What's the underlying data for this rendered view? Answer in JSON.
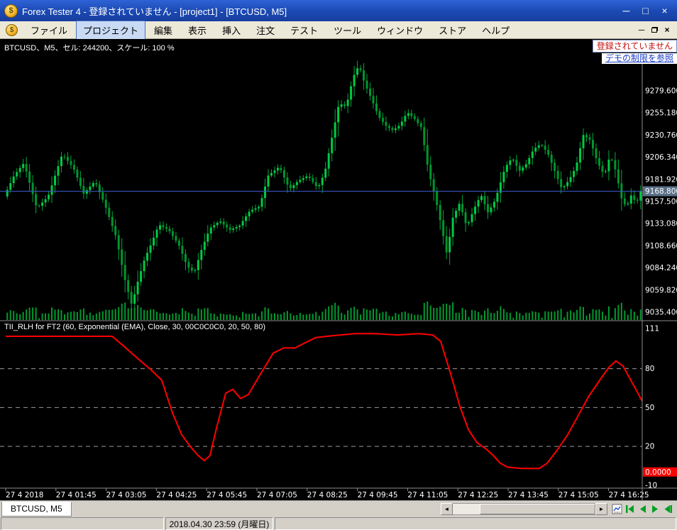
{
  "titlebar": {
    "title": "Forex Tester 4 - 登録されていません - [project1] - [BTCUSD, M5]",
    "minimize": "─",
    "maximize": "□",
    "close": "×"
  },
  "menubar": {
    "items": [
      "ファイル",
      "プロジェクト",
      "編集",
      "表示",
      "挿入",
      "注文",
      "テスト",
      "ツール",
      "ウィンドウ",
      "ストア",
      "ヘルプ"
    ],
    "item_names": [
      "file",
      "project",
      "edit",
      "view",
      "insert",
      "orders",
      "test",
      "tools",
      "window",
      "store",
      "help"
    ],
    "active": "プロジェクト",
    "mdi_minimize": "─",
    "mdi_close": "×"
  },
  "notice": {
    "registration": "登録されていません",
    "link": "デモの制限を参照"
  },
  "main_chart": {
    "info_label": "BTCUSD、M5、セル: 244200、スケール: 100 %",
    "price_labels": [
      "9279.600",
      "9255.180",
      "9230.760",
      "9206.340",
      "9181.920",
      "9157.500",
      "9133.080",
      "9108.660",
      "9084.240",
      "9059.820",
      "9035.400"
    ],
    "current_price_label": "9168.800"
  },
  "indicator_pane": {
    "info_label": "TII_RLH for FT2 (60, Exponential (EMA), Close, 30, 00C0C0C0, 20, 50, 80)",
    "value_labels": [
      "111",
      "80",
      "50",
      "20",
      "-10"
    ],
    "current_value_label": "0.0000"
  },
  "time_axis": {
    "labels": [
      "27 4 2018",
      "27 4 01:45",
      "27 4 03:05",
      "27 4 04:25",
      "27 4 05:45",
      "27 4 07:05",
      "27 4 08:25",
      "27 4 09:45",
      "27 4 11:05",
      "27 4 12:25",
      "27 4 13:45",
      "27 4 15:05",
      "27 4 16:25"
    ]
  },
  "bottom_bar": {
    "tab": "BTCUSD, M5",
    "scroll_left": "◄",
    "scroll_right": "►"
  },
  "status_bar": {
    "datetime": "2018.04.30 23:59 (月曜日)"
  },
  "colors": {
    "candle_up": "#00ca44",
    "candle_down": "#00962e",
    "wick": "#00a83a",
    "volume": "#009a2e",
    "indicator_line": "#ff0000",
    "current_price_line": "#3c5ac8",
    "price_tag_bg": "#5a7088",
    "value_tag_bg": "#ff0000",
    "grid": "#9a9a9a",
    "pane_border": "#8c8c8c"
  },
  "chart_data": [
    {
      "type": "candlestick",
      "symbol": "BTCUSD",
      "timeframe": "M5",
      "title": "BTCUSD, M5",
      "y_ticks": [
        9279.6,
        9255.18,
        9230.76,
        9206.34,
        9181.92,
        9157.5,
        9133.08,
        9108.66,
        9084.24,
        9059.82,
        9035.4
      ],
      "x_ticks": [
        "27 4 2018",
        "27 4 01:45",
        "27 4 03:05",
        "27 4 04:25",
        "27 4 05:45",
        "27 4 07:05",
        "27 4 08:25",
        "27 4 09:45",
        "27 4 11:05",
        "27 4 12:25",
        "27 4 13:45",
        "27 4 15:05",
        "27 4 16:25"
      ],
      "current_price": 9168.8,
      "approx_price_range": [
        9035,
        9315
      ],
      "has_volume": true,
      "price_path": [
        [
          0,
          9163
        ],
        [
          14,
          9186
        ],
        [
          28,
          9200
        ],
        [
          46,
          9150
        ],
        [
          62,
          9163
        ],
        [
          82,
          9210
        ],
        [
          98,
          9194
        ],
        [
          112,
          9166
        ],
        [
          128,
          9180
        ],
        [
          142,
          9154
        ],
        [
          158,
          9118
        ],
        [
          170,
          9072
        ],
        [
          180,
          9043
        ],
        [
          188,
          9068
        ],
        [
          198,
          9094
        ],
        [
          208,
          9112
        ],
        [
          218,
          9132
        ],
        [
          232,
          9126
        ],
        [
          246,
          9110
        ],
        [
          258,
          9086
        ],
        [
          268,
          9079
        ],
        [
          278,
          9104
        ],
        [
          290,
          9128
        ],
        [
          304,
          9136
        ],
        [
          318,
          9126
        ],
        [
          332,
          9131
        ],
        [
          346,
          9147
        ],
        [
          360,
          9152
        ],
        [
          372,
          9186
        ],
        [
          388,
          9196
        ],
        [
          402,
          9171
        ],
        [
          414,
          9180
        ],
        [
          428,
          9186
        ],
        [
          442,
          9172
        ],
        [
          452,
          9190
        ],
        [
          462,
          9228
        ],
        [
          472,
          9266
        ],
        [
          482,
          9262
        ],
        [
          492,
          9295
        ],
        [
          500,
          9308
        ],
        [
          508,
          9288
        ],
        [
          518,
          9270
        ],
        [
          528,
          9251
        ],
        [
          538,
          9241
        ],
        [
          548,
          9236
        ],
        [
          558,
          9242
        ],
        [
          568,
          9256
        ],
        [
          578,
          9249
        ],
        [
          588,
          9239
        ],
        [
          598,
          9191
        ],
        [
          608,
          9161
        ],
        [
          616,
          9131
        ],
        [
          624,
          9099
        ],
        [
          632,
          9139
        ],
        [
          642,
          9156
        ],
        [
          652,
          9129
        ],
        [
          662,
          9149
        ],
        [
          672,
          9165
        ],
        [
          682,
          9145
        ],
        [
          692,
          9159
        ],
        [
          706,
          9195
        ],
        [
          716,
          9206
        ],
        [
          726,
          9191
        ],
        [
          736,
          9199
        ],
        [
          746,
          9215
        ],
        [
          756,
          9221
        ],
        [
          766,
          9211
        ],
        [
          776,
          9191
        ],
        [
          786,
          9171
        ],
        [
          796,
          9181
        ],
        [
          806,
          9196
        ],
        [
          816,
          9231
        ],
        [
          826,
          9225
        ],
        [
          836,
          9201
        ],
        [
          846,
          9186
        ],
        [
          854,
          9209
        ],
        [
          862,
          9191
        ],
        [
          870,
          9161
        ],
        [
          877,
          9151
        ],
        [
          884,
          9165
        ],
        [
          891,
          9155
        ],
        [
          897,
          9168.8
        ]
      ]
    },
    {
      "type": "line",
      "name": "TII_RLH for FT2",
      "params": "60, Exponential (EMA), Close, 30, 00C0C0C0, 20, 50, 80",
      "y_ticks": [
        111,
        80,
        50,
        20,
        -10
      ],
      "levels": [
        20,
        50,
        80
      ],
      "ylim": [
        -10,
        111
      ],
      "last_value": 0.0,
      "points": [
        [
          0,
          105
        ],
        [
          150,
          105
        ],
        [
          165,
          98
        ],
        [
          190,
          86
        ],
        [
          205,
          79
        ],
        [
          220,
          71
        ],
        [
          235,
          46
        ],
        [
          248,
          29
        ],
        [
          260,
          20
        ],
        [
          271,
          13
        ],
        [
          280,
          9
        ],
        [
          288,
          13
        ],
        [
          297,
          34
        ],
        [
          310,
          61
        ],
        [
          320,
          64
        ],
        [
          331,
          57
        ],
        [
          342,
          60
        ],
        [
          357,
          74
        ],
        [
          377,
          92
        ],
        [
          392,
          96
        ],
        [
          408,
          96
        ],
        [
          422,
          100
        ],
        [
          437,
          104
        ],
        [
          452,
          105
        ],
        [
          472,
          106
        ],
        [
          492,
          107
        ],
        [
          522,
          107
        ],
        [
          552,
          106
        ],
        [
          582,
          107
        ],
        [
          602,
          106
        ],
        [
          613,
          101
        ],
        [
          627,
          76
        ],
        [
          640,
          51
        ],
        [
          652,
          33
        ],
        [
          664,
          23
        ],
        [
          677,
          18
        ],
        [
          687,
          13
        ],
        [
          697,
          7
        ],
        [
          707,
          4
        ],
        [
          727,
          3
        ],
        [
          752,
          3
        ],
        [
          763,
          7
        ],
        [
          777,
          17
        ],
        [
          792,
          29
        ],
        [
          807,
          44
        ],
        [
          822,
          59
        ],
        [
          837,
          71
        ],
        [
          850,
          81
        ],
        [
          860,
          86
        ],
        [
          870,
          82
        ],
        [
          882,
          70
        ],
        [
          891,
          61
        ],
        [
          897,
          55
        ]
      ]
    }
  ]
}
